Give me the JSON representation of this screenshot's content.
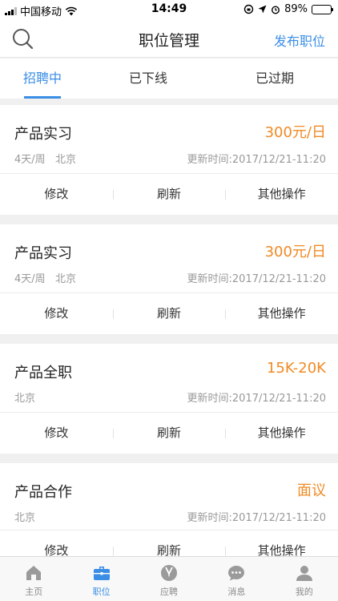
{
  "status_bar": {
    "carrier": "中国移动",
    "time": "14:49",
    "battery": "89%",
    "battery_level": 0.89
  },
  "header": {
    "title": "职位管理",
    "publish_label": "发布职位",
    "search_icon": "search-icon"
  },
  "tabs": [
    {
      "label": "招聘中",
      "active": true
    },
    {
      "label": "已下线",
      "active": false
    },
    {
      "label": "已过期",
      "active": false
    }
  ],
  "jobs": [
    {
      "title": "产品实习",
      "salary": "300元/日",
      "meta": "4天/周   北京",
      "updated": "更新时间:2017/12/21-11:20"
    },
    {
      "title": "产品实习",
      "salary": "300元/日",
      "meta": "4天/周   北京",
      "updated": "更新时间:2017/12/21-11:20"
    },
    {
      "title": "产品全职",
      "salary": "15K-20K",
      "meta": "北京",
      "updated": "更新时间:2017/12/21-11:20"
    },
    {
      "title": "产品合作",
      "salary": "面议",
      "meta": "北京",
      "updated": "更新时间:2017/12/21-11:20"
    }
  ],
  "job_actions": {
    "edit": "修改",
    "refresh": "刷新",
    "more": "其他操作"
  },
  "tabbar": [
    {
      "label": "主页",
      "icon": "home-icon",
      "active": false
    },
    {
      "label": "职位",
      "icon": "briefcase-icon",
      "active": true
    },
    {
      "label": "应聘",
      "icon": "suit-icon",
      "active": false
    },
    {
      "label": "消息",
      "icon": "chat-bubble-icon",
      "active": false
    },
    {
      "label": "我的",
      "icon": "person-icon",
      "active": false
    }
  ],
  "colors": {
    "accent": "#3a8ee6",
    "salary": "#f08a24",
    "inactive": "#8a8a8a"
  }
}
